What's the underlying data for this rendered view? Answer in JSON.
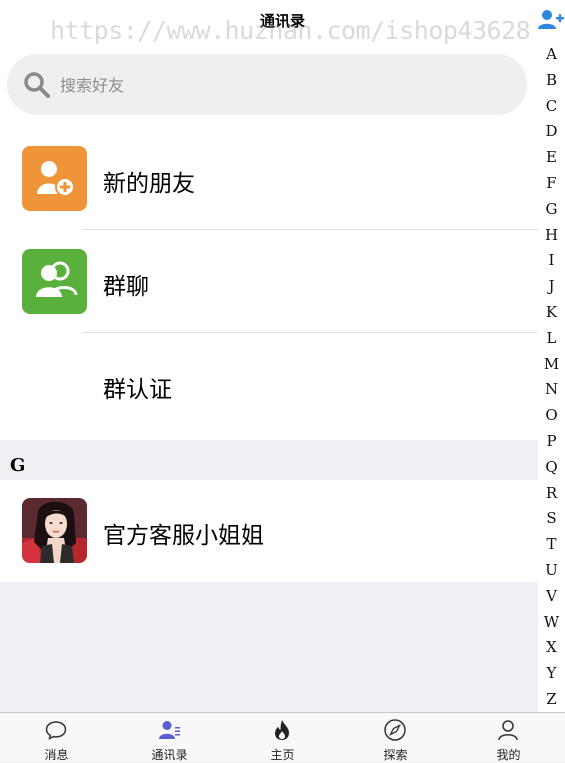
{
  "header": {
    "title": "通讯录",
    "watermark": "https://www.huzhan.com/ishop43628",
    "add_friend_icon": "add-person-icon"
  },
  "search": {
    "placeholder": "搜索好友",
    "icon": "search-icon"
  },
  "menu_items": [
    {
      "label": "新的朋友",
      "icon": "new-friend-icon",
      "color": "#f0943a"
    },
    {
      "label": "群聊",
      "icon": "group-chat-icon",
      "color": "#5ab03c"
    },
    {
      "label": "群认证",
      "icon": "",
      "color": ""
    }
  ],
  "sections": [
    {
      "letter": "G",
      "contacts": [
        {
          "name": "官方客服小姐姐",
          "avatar": "avatar-photo"
        }
      ]
    }
  ],
  "alphabet": [
    "A",
    "B",
    "C",
    "D",
    "E",
    "F",
    "G",
    "H",
    "I",
    "J",
    "K",
    "L",
    "M",
    "N",
    "O",
    "P",
    "Q",
    "R",
    "S",
    "T",
    "U",
    "V",
    "W",
    "X",
    "Y",
    "Z"
  ],
  "tabbar": {
    "items": [
      {
        "label": "消息",
        "icon": "chat-bubble-icon",
        "active": false
      },
      {
        "label": "通讯录",
        "icon": "contacts-icon",
        "active": true
      },
      {
        "label": "主页",
        "icon": "flame-icon",
        "active": false
      },
      {
        "label": "探索",
        "icon": "compass-icon",
        "active": false
      },
      {
        "label": "我的",
        "icon": "person-icon",
        "active": false
      }
    ],
    "active_color": "#5b5fd6"
  }
}
